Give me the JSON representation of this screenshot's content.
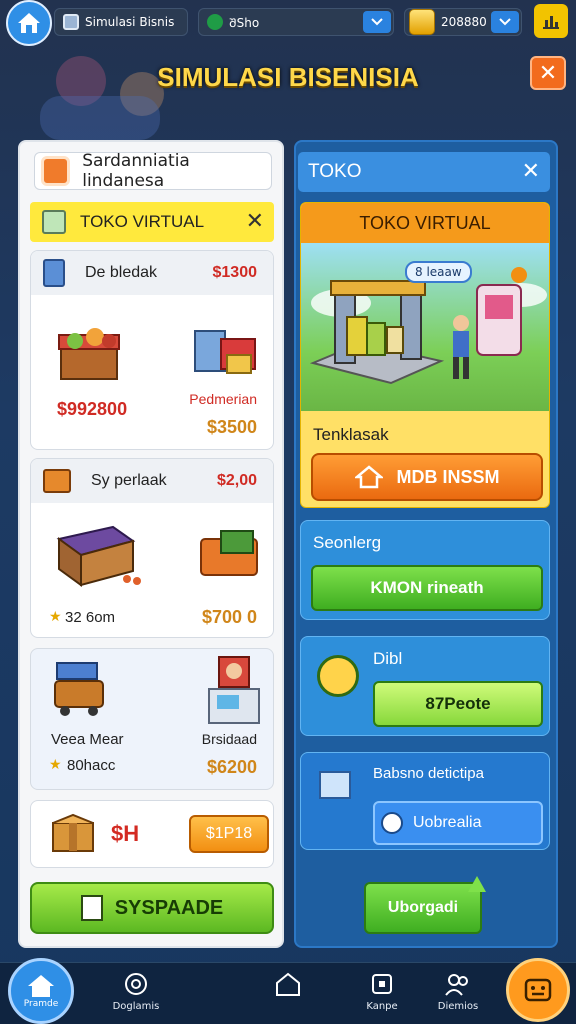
{
  "topbar": {
    "pill1_label": "Simulasi Bisnis",
    "pill2_label": "ᲨSho",
    "coins": "208880"
  },
  "title": "SIMULASI BISENISIA",
  "left_panel": {
    "header_label": "Sardanniatia lindanesa",
    "toko_bar_label": "TOKO VIRTUAL",
    "card1": {
      "name": "De bledak",
      "price": "$1300",
      "item_price": "$992800",
      "sub_name": "Pedmerian",
      "sub_price": "$3500"
    },
    "card2": {
      "name": "Sy perlaak",
      "price": "$2,00",
      "stat": "32 6om",
      "item_price": "$700 0"
    },
    "card3": {
      "name_left": "Veea Mear",
      "stat_left": "80hacc",
      "name_right": "Brsidaad",
      "price_right": "$6200"
    },
    "card4": {
      "badge": "$H",
      "button": "$1P18"
    },
    "main_button": "SYSPAADE"
  },
  "right_panel": {
    "header_label": "TOKO",
    "shop_title": "TOKO VIRTUAL",
    "shop_tag": "8 leaaw",
    "shop_sub": "Tenklasak",
    "shop_button": "MDB INSSM",
    "card1": {
      "label": "Seonlerg",
      "button": "KMON rineath"
    },
    "card2": {
      "label": "Dibl",
      "button": "87Peote"
    },
    "card3": {
      "label": "Babsno detictipa",
      "button": "Uobrealia"
    },
    "upgrade_button": "Uborgadi"
  },
  "nav": {
    "home": "Pramde",
    "item2": "Doglamis",
    "item4": "Kanpe",
    "item5": "Diemios"
  }
}
